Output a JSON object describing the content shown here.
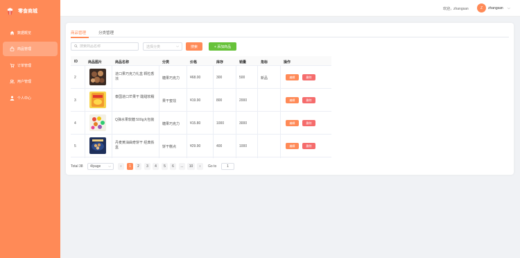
{
  "brand": {
    "name": "零食商城",
    "icon": "popcorn-icon"
  },
  "sidebar": {
    "items": [
      {
        "label": "数据概览",
        "icon": "home-icon"
      },
      {
        "label": "商品管理",
        "icon": "bag-icon",
        "active": true
      },
      {
        "label": "订单管理",
        "icon": "cart-icon"
      },
      {
        "label": "用户管理",
        "icon": "users-icon"
      },
      {
        "label": "个人中心",
        "icon": "user-icon"
      }
    ]
  },
  "header": {
    "welcome": "欢迎，zhangsan",
    "avatar_letter": "Z",
    "username": "zhangsan",
    "caret": "⌵"
  },
  "tabs": [
    {
      "label": "商品管理",
      "active": true
    },
    {
      "label": "分类管理",
      "active": false
    }
  ],
  "toolbar": {
    "search_placeholder": "搜索商品名称",
    "category_placeholder": "选择分类",
    "search_button": "搜索",
    "add_button": "+ 添加商品"
  },
  "table": {
    "columns": [
      "ID",
      "商品图片",
      "商品名称",
      "分类",
      "价格",
      "库存",
      "销量",
      "角标",
      "操作"
    ],
    "rows": [
      {
        "id": "2",
        "name": "进口果巧克力礼盒 颗粒香浓",
        "category": "糖果巧克力",
        "price": "¥68.00",
        "stock": "300",
        "sales": "500",
        "badge": "新品",
        "edit": "编辑",
        "delete": "删除"
      },
      {
        "id": "3",
        "name": "泰国进口芒果干 酸甜软糯",
        "category": "果干蜜饯",
        "price": "¥19.90",
        "stock": "800",
        "sales": "2000",
        "badge": "",
        "edit": "编辑",
        "delete": "删除"
      },
      {
        "id": "4",
        "name": "Q弹水果软糖 500g大包装",
        "category": "糖果巧克力",
        "price": "¥15.80",
        "stock": "1000",
        "sales": "3000",
        "badge": "",
        "edit": "编辑",
        "delete": "删除"
      },
      {
        "id": "5",
        "name": "丹麦黄油曲奇饼干 经典铁盒",
        "category": "饼干糕点",
        "price": "¥29.90",
        "stock": "400",
        "sales": "1000",
        "badge": "",
        "edit": "编辑",
        "delete": "删除"
      }
    ]
  },
  "pagination": {
    "total": "Total 38",
    "page_size": "4/page",
    "prev": "‹",
    "next": "›",
    "pages": [
      "1",
      "2",
      "3",
      "4",
      "5",
      "6",
      "...",
      "10"
    ],
    "current": "1",
    "goto_label": "Go to",
    "goto_value": "1"
  },
  "colors": {
    "accent": "#ff8a57",
    "success": "#67c23a",
    "danger": "#f56c6c"
  }
}
